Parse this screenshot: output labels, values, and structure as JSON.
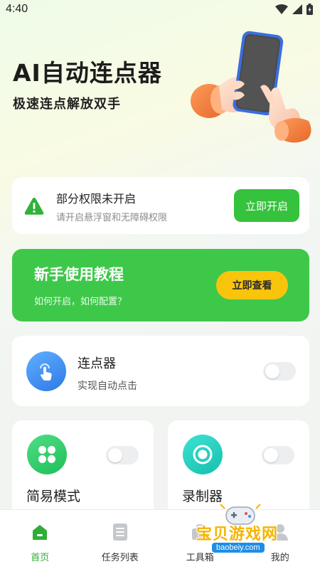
{
  "status_bar": {
    "time": "4:40"
  },
  "hero": {
    "title": "AI自动连点器",
    "subtitle": "极速连点解放双手"
  },
  "permission_card": {
    "title": "部分权限未开启",
    "description": "请开启悬浮窗和无障碍权限",
    "button_label": "立即开启"
  },
  "tutorial_card": {
    "title": "新手使用教程",
    "description": "如何开启，如何配置？",
    "button_label": "立即查看"
  },
  "clicker": {
    "title": "连点器",
    "description": "实现自动点击",
    "enabled": false
  },
  "modes": [
    {
      "title": "简易模式",
      "icon": "clover-icon",
      "enabled": false
    },
    {
      "title": "录制器",
      "icon": "record-icon",
      "enabled": false
    }
  ],
  "bottom_nav": {
    "items": [
      {
        "label": "首页",
        "icon": "home-icon",
        "active": true
      },
      {
        "label": "任务列表",
        "icon": "document-list-icon",
        "active": false
      },
      {
        "label": "工具箱",
        "icon": "toolbox-icon",
        "active": false
      },
      {
        "label": "我的",
        "icon": "profile-icon",
        "active": false
      }
    ]
  },
  "watermark": {
    "text": "宝贝游戏网",
    "url": "baobeiy.com"
  },
  "colors": {
    "accent_green": "#35c23c",
    "tutorial_green": "#3ec84a",
    "button_yellow": "#f9c40c",
    "clicker_blue": "#2e78e6",
    "record_teal": "#16bfae"
  }
}
